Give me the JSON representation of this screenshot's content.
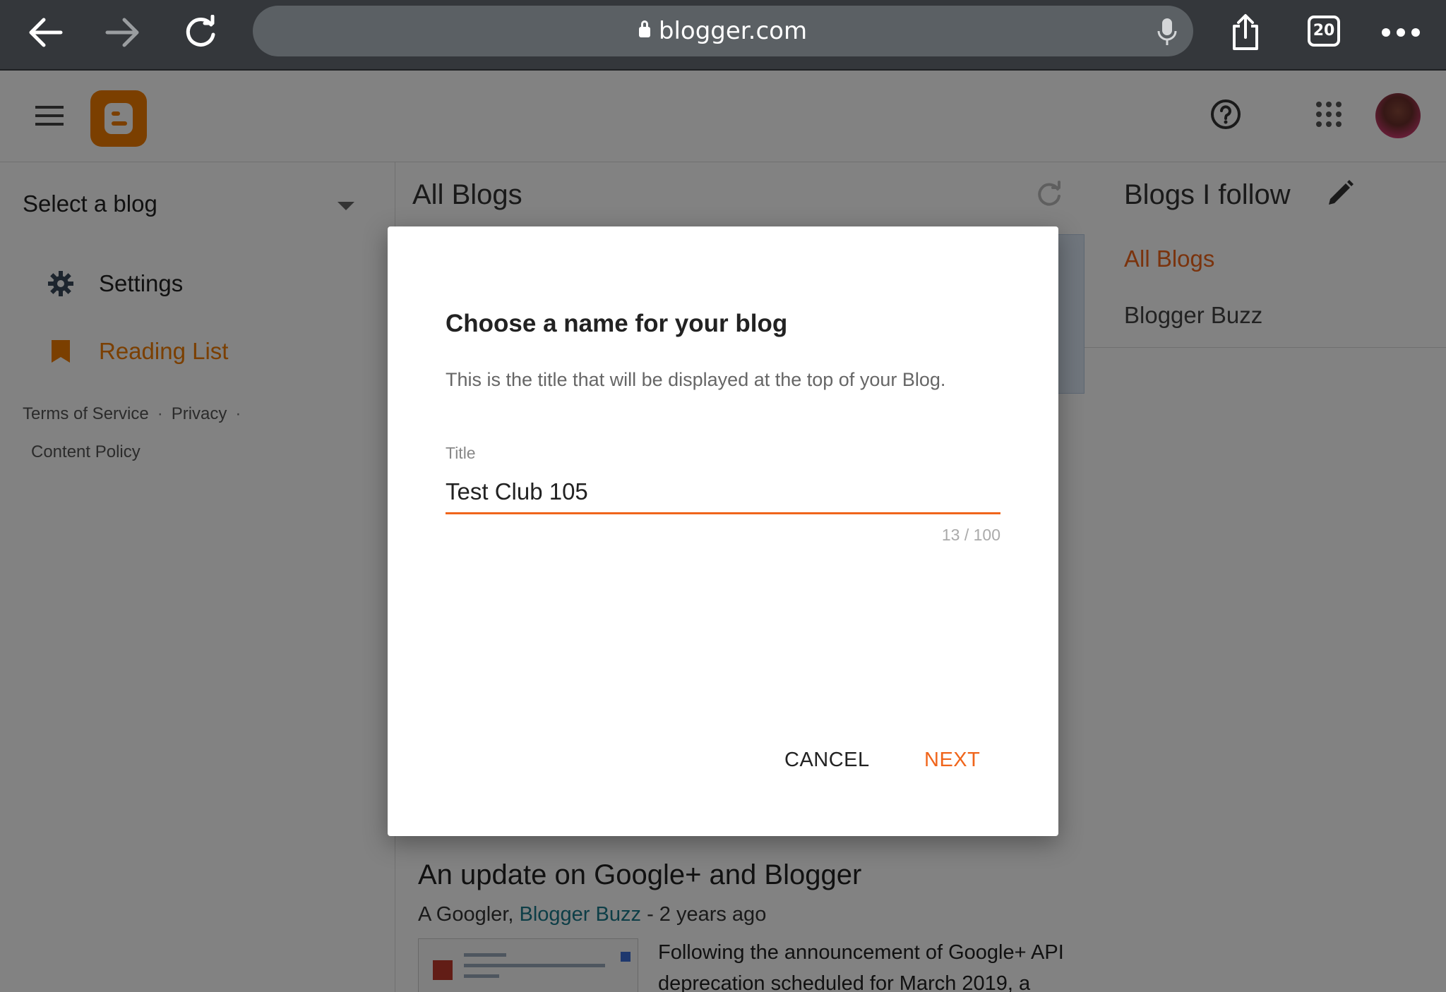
{
  "browser": {
    "url": "blogger.com",
    "tab_count": "20"
  },
  "colors": {
    "accent": "#f0651b",
    "logo": "#f27d00",
    "link_teal": "#1a7a8c"
  },
  "sidebar": {
    "select_blog": "Select a blog",
    "items": [
      {
        "label": "Settings",
        "icon": "gear-icon"
      },
      {
        "label": "Reading List",
        "icon": "bookmark-icon"
      }
    ],
    "footer": {
      "terms": "Terms of Service",
      "privacy": "Privacy",
      "content_policy": "Content Policy"
    }
  },
  "main": {
    "title": "All Blogs",
    "post": {
      "title": "An update on Google+ and Blogger",
      "author": "A Googler,",
      "blog": "Blogger Buzz",
      "age": "- 2 years ago",
      "excerpt": "Following the announcement of Google+ API deprecation scheduled for March 2019, a"
    }
  },
  "right": {
    "title": "Blogs I follow",
    "items": [
      "All Blogs",
      "Blogger Buzz"
    ]
  },
  "modal": {
    "title": "Choose a name for your blog",
    "description": "This is the title that will be displayed at the top of your Blog.",
    "field_label": "Title",
    "field_value": "Test Club 105",
    "char_count": "13 / 100",
    "cancel": "CANCEL",
    "next": "NEXT"
  }
}
